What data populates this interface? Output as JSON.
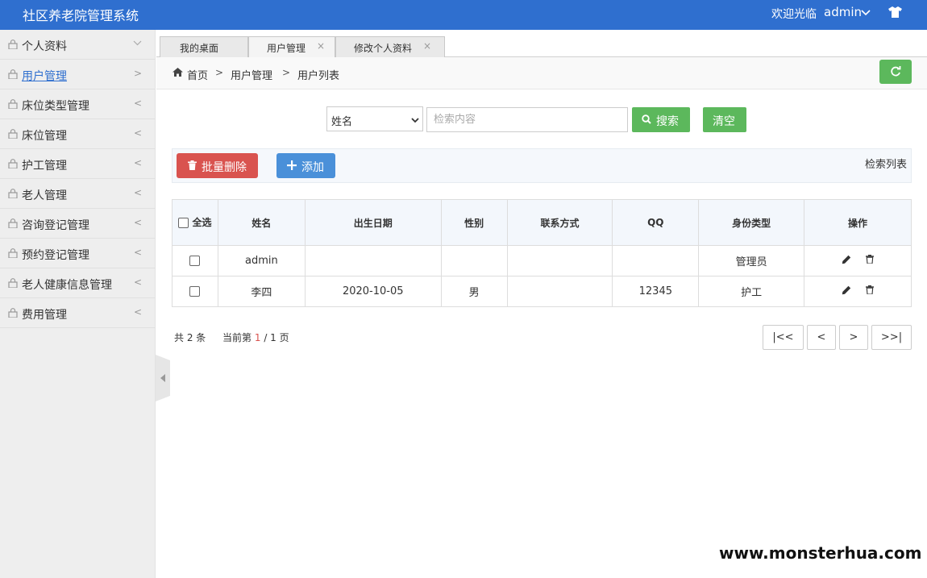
{
  "header": {
    "title": "社区养老院管理系统",
    "welcome": "欢迎光临",
    "user": "admin"
  },
  "sidebar": {
    "items": [
      {
        "label": "个人资料",
        "arrow": "down"
      },
      {
        "label": "用户管理",
        "arrow": ">"
      },
      {
        "label": "床位类型管理",
        "arrow": "<"
      },
      {
        "label": "床位管理",
        "arrow": "<"
      },
      {
        "label": "护工管理",
        "arrow": "<"
      },
      {
        "label": "老人管理",
        "arrow": "<"
      },
      {
        "label": "咨询登记管理",
        "arrow": "<"
      },
      {
        "label": "预约登记管理",
        "arrow": "<"
      },
      {
        "label": "老人健康信息管理",
        "arrow": "<"
      },
      {
        "label": "费用管理",
        "arrow": "<"
      }
    ]
  },
  "tabs": [
    {
      "label": "我的桌面"
    },
    {
      "label": "用户管理",
      "close": "×"
    },
    {
      "label": "修改个人资料",
      "close": "×"
    }
  ],
  "breadcrumb": {
    "home": "首页",
    "sep": ">",
    "level1": "用户管理",
    "level2": "用户列表"
  },
  "search": {
    "field": "姓名",
    "placeholder": "检索内容",
    "search_label": "搜索",
    "clear_label": "清空"
  },
  "toolbar": {
    "batch_delete": "批量删除",
    "add": "添加",
    "list_title": "检索列表"
  },
  "table": {
    "select_all": "全选",
    "columns": [
      "姓名",
      "出生日期",
      "性别",
      "联系方式",
      "QQ",
      "身份类型",
      "操作"
    ],
    "rows": [
      {
        "name": "admin",
        "birth": "",
        "gender": "",
        "contact": "",
        "qq": "",
        "role": "管理员"
      },
      {
        "name": "李四",
        "birth": "2020-10-05",
        "gender": "男",
        "contact": "",
        "qq": "12345",
        "role": "护工"
      }
    ]
  },
  "pagination": {
    "total": "共 2 条",
    "current_prefix": "当前第",
    "current": "1",
    "current_suffix": "/ 1 页",
    "first": "|<<",
    "prev": "<",
    "next": ">",
    "last": ">>|"
  },
  "watermark": "www.monsterhua.com"
}
